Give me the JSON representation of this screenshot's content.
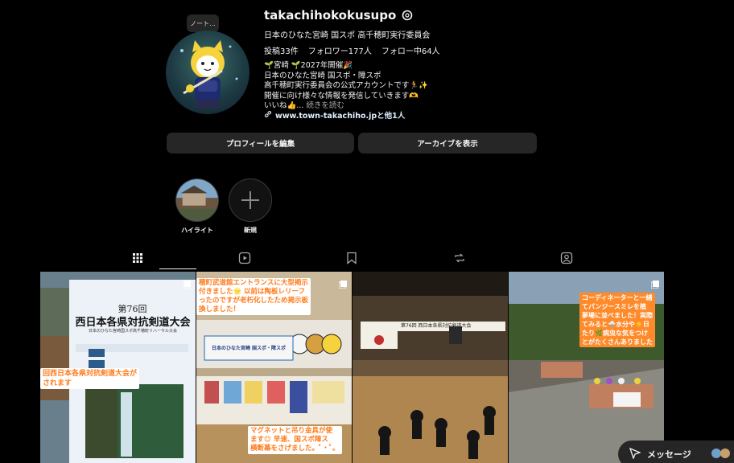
{
  "profile": {
    "username": "takachihokokusupo",
    "full_name": "日本のひなた宮崎 国スポ 高千穂町実行委員会",
    "note": "ノート...",
    "stats": {
      "posts": "投稿33件",
      "followers": "フォロワー177人",
      "following": "フォロー中64人"
    },
    "bio_lines": [
      "🌱宮崎 🌱2027年開催🎉",
      "日本のひなた宮崎 国スポ・障スポ",
      "高千穂町実行委員会の公式アカウントです🏃✨",
      "開催に向け様々な情報を発信していきます🫶"
    ],
    "bio_last": "いいね👍...",
    "bio_more": "続きを読む",
    "link": "www.town-takachiho.jpと他1人"
  },
  "buttons": {
    "edit_profile": "プロフィールを編集",
    "archive": "アーカイブを表示"
  },
  "highlights": [
    {
      "label": "ハイライト"
    },
    {
      "label": "新規"
    }
  ],
  "posts": [
    {
      "poster_title": "第76回",
      "poster_main": "西日本各県対抗剣道大会",
      "poster_sub": "日本のひなた宮崎国スポ高千穂町リハーサル大会",
      "caption": "回西日本各県対抗剣道大会が\nされます"
    },
    {
      "caption_top": "穂町武道館エントランスに大型掲示\n付きました🌟 以前は陶板レリーフ\nったのですが老朽化したため掲示板\n換しました！",
      "banner_text": "日本のひなた宮崎 国スポ・障スポ",
      "caption_bottom": "マグネットと吊り金具が使\nます😊 早速、国スポ障ス\n横断幕をさげました。ﾟ•ﾟ。"
    },
    {
      "banner_text": "第76回 西日本各県対抗剣道大会"
    },
    {
      "caption": "コーディネーターと一緒\nてパンジースミレを植\n夢場に並べました！実際\nてみると🌧️水分や☀️日\nたり🌿病虫な気をつけ\nとがたくさんありました"
    }
  ],
  "message_bar": {
    "label": "メッセージ"
  },
  "colors": {
    "background": "#000000",
    "button_bg": "#262626",
    "text": "#f5f5f5",
    "link": "#e0f1ff",
    "caption_orange": "#ff7a1a"
  }
}
